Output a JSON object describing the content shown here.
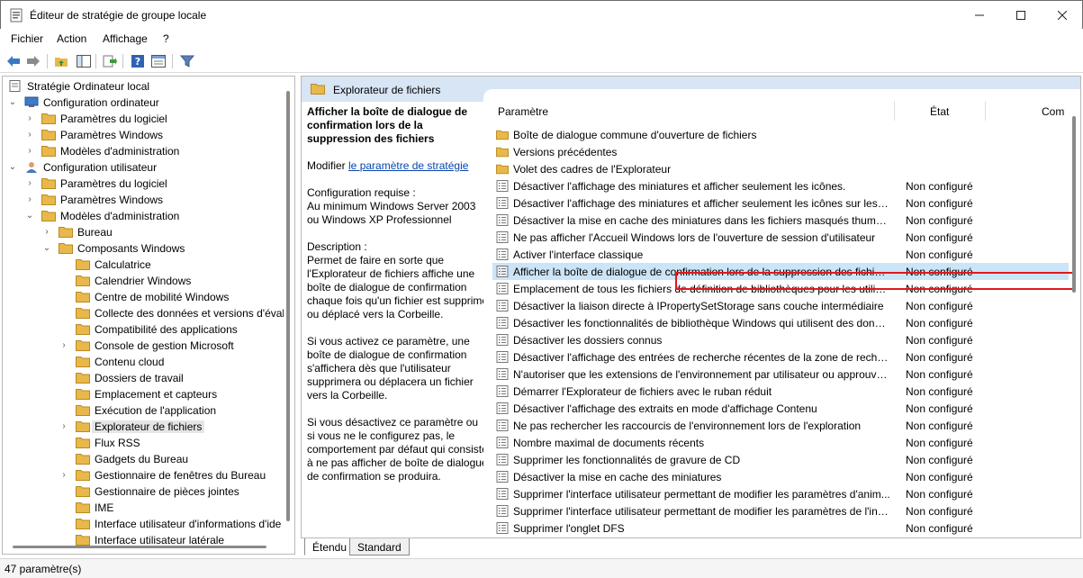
{
  "window": {
    "title": "Éditeur de stratégie de groupe locale"
  },
  "menu": [
    "Fichier",
    "Action",
    "Affichage",
    "?"
  ],
  "toolbar": {
    "icons": [
      "back-arrow-icon",
      "forward-arrow-icon",
      "up-folder-icon",
      "show-hide-tree-icon",
      "export-list-icon",
      "help-icon",
      "properties-icon",
      "filter-icon"
    ]
  },
  "tree": {
    "root": "Stratégie Ordinateur local",
    "nodes": [
      {
        "label": "Configuration ordinateur",
        "depth": 1,
        "expander": "open",
        "icon": "computer-icon"
      },
      {
        "label": "Paramètres du logiciel",
        "depth": 2,
        "expander": "closed",
        "icon": "folder-icon"
      },
      {
        "label": "Paramètres Windows",
        "depth": 2,
        "expander": "closed",
        "icon": "folder-icon"
      },
      {
        "label": "Modèles d'administration",
        "depth": 2,
        "expander": "closed",
        "icon": "folder-icon"
      },
      {
        "label": "Configuration utilisateur",
        "depth": 1,
        "expander": "open",
        "icon": "user-icon"
      },
      {
        "label": "Paramètres du logiciel",
        "depth": 2,
        "expander": "closed",
        "icon": "folder-icon"
      },
      {
        "label": "Paramètres Windows",
        "depth": 2,
        "expander": "closed",
        "icon": "folder-icon"
      },
      {
        "label": "Modèles d'administration",
        "depth": 2,
        "expander": "open",
        "icon": "folder-icon"
      },
      {
        "label": "Bureau",
        "depth": 3,
        "expander": "closed",
        "icon": "folder-icon"
      },
      {
        "label": "Composants Windows",
        "depth": 3,
        "expander": "open",
        "icon": "folder-icon"
      },
      {
        "label": "Calculatrice",
        "depth": 4,
        "expander": "none",
        "icon": "folder-icon"
      },
      {
        "label": "Calendrier Windows",
        "depth": 4,
        "expander": "none",
        "icon": "folder-icon"
      },
      {
        "label": "Centre de mobilité Windows",
        "depth": 4,
        "expander": "none",
        "icon": "folder-icon"
      },
      {
        "label": "Collecte des données et versions d'évalu",
        "depth": 4,
        "expander": "none",
        "icon": "folder-icon"
      },
      {
        "label": "Compatibilité des applications",
        "depth": 4,
        "expander": "none",
        "icon": "folder-icon"
      },
      {
        "label": "Console de gestion Microsoft",
        "depth": 4,
        "expander": "closed",
        "icon": "folder-icon"
      },
      {
        "label": "Contenu cloud",
        "depth": 4,
        "expander": "none",
        "icon": "folder-icon"
      },
      {
        "label": "Dossiers de travail",
        "depth": 4,
        "expander": "none",
        "icon": "folder-icon"
      },
      {
        "label": "Emplacement et capteurs",
        "depth": 4,
        "expander": "none",
        "icon": "folder-icon"
      },
      {
        "label": "Exécution de l'application",
        "depth": 4,
        "expander": "none",
        "icon": "folder-icon"
      },
      {
        "label": "Explorateur de fichiers",
        "depth": 4,
        "expander": "closed",
        "icon": "folder-icon",
        "selected": true
      },
      {
        "label": "Flux RSS",
        "depth": 4,
        "expander": "none",
        "icon": "folder-icon"
      },
      {
        "label": "Gadgets du Bureau",
        "depth": 4,
        "expander": "none",
        "icon": "folder-icon"
      },
      {
        "label": "Gestionnaire de fenêtres du Bureau",
        "depth": 4,
        "expander": "closed",
        "icon": "folder-icon"
      },
      {
        "label": "Gestionnaire de pièces jointes",
        "depth": 4,
        "expander": "none",
        "icon": "folder-icon"
      },
      {
        "label": "IME",
        "depth": 4,
        "expander": "none",
        "icon": "folder-icon"
      },
      {
        "label": "Interface utilisateur d'informations d'ide",
        "depth": 4,
        "expander": "none",
        "icon": "folder-icon"
      },
      {
        "label": "Interface utilisateur latérale",
        "depth": 4,
        "expander": "none",
        "icon": "folder-icon"
      }
    ]
  },
  "right": {
    "header": "Explorateur de fichiers",
    "description": {
      "title": "Afficher la boîte de dialogue de confirmation lors de la suppression des fichiers",
      "modify_prefix": "Modifier ",
      "modify_link": "le paramètre de stratégie",
      "requirements": "Configuration requise :\nAu minimum Windows Server 2003 ou Windows XP Professionnel",
      "desc_label": "Description :",
      "desc_body": "Permet de faire en sorte que l'Explorateur de fichiers affiche une boîte de dialogue de confirmation chaque fois qu'un fichier est supprimé ou déplacé vers la Corbeille.",
      "enabled": "Si vous activez ce paramètre, une boîte de dialogue de confirmation s'affichera dès que l'utilisateur supprimera ou déplacera un fichier vers la Corbeille.",
      "disabled": "Si vous désactivez ce paramètre ou si vous ne le configurez pas, le comportement par défaut qui consiste à ne pas afficher de boîte de dialogue de confirmation se produira."
    },
    "columns": [
      "Paramètre",
      "État",
      "Com"
    ],
    "rows": [
      {
        "name": "Boîte de dialogue commune d'ouverture de fichiers",
        "state": "",
        "type": "folder"
      },
      {
        "name": "Versions précédentes",
        "state": "",
        "type": "folder"
      },
      {
        "name": "Volet des cadres de l'Explorateur",
        "state": "",
        "type": "folder"
      },
      {
        "name": "Désactiver l'affichage des miniatures et afficher seulement les icônes.",
        "state": "Non configuré",
        "type": "setting"
      },
      {
        "name": "Désactiver l'affichage des miniatures et afficher seulement les icônes sur les do...",
        "state": "Non configuré",
        "type": "setting"
      },
      {
        "name": "Désactiver la mise en cache des miniatures dans les fichiers masqués thumbs.db",
        "state": "Non configuré",
        "type": "setting"
      },
      {
        "name": "Ne pas afficher l'Accueil Windows lors de l'ouverture de session d'utilisateur",
        "state": "Non configuré",
        "type": "setting"
      },
      {
        "name": "Activer l'interface classique",
        "state": "Non configuré",
        "type": "setting"
      },
      {
        "name": "Afficher la boîte de dialogue de confirmation lors de la suppression des fichiers",
        "state": "Non configuré",
        "type": "setting",
        "selected": true
      },
      {
        "name": "Emplacement de tous les fichiers de définition de bibliothèques pour les utilisa...",
        "state": "Non configuré",
        "type": "setting"
      },
      {
        "name": "Désactiver la liaison directe à IPropertySetStorage sans couche intermédiaire",
        "state": "Non configuré",
        "type": "setting"
      },
      {
        "name": "Désactiver les fonctionnalités de bibliothèque Windows qui utilisent des donné...",
        "state": "Non configuré",
        "type": "setting"
      },
      {
        "name": "Désactiver les dossiers connus",
        "state": "Non configuré",
        "type": "setting"
      },
      {
        "name": "Désactiver l'affichage des entrées de recherche récentes de la zone de recherch...",
        "state": "Non configuré",
        "type": "setting"
      },
      {
        "name": "N'autoriser que les extensions de l'environnement par utilisateur ou approuvées",
        "state": "Non configuré",
        "type": "setting"
      },
      {
        "name": "Démarrer l'Explorateur de fichiers avec le ruban réduit",
        "state": "Non configuré",
        "type": "setting"
      },
      {
        "name": "Désactiver l'affichage des extraits en mode d'affichage Contenu",
        "state": "Non configuré",
        "type": "setting"
      },
      {
        "name": "Ne pas rechercher les raccourcis de l'environnement lors de l'exploration",
        "state": "Non configuré",
        "type": "setting"
      },
      {
        "name": "Nombre maximal de documents récents",
        "state": "Non configuré",
        "type": "setting"
      },
      {
        "name": "Supprimer les fonctionnalités de gravure de CD",
        "state": "Non configuré",
        "type": "setting"
      },
      {
        "name": "Désactiver la mise en cache des miniatures",
        "state": "Non configuré",
        "type": "setting"
      },
      {
        "name": "Supprimer l'interface utilisateur permettant de modifier les paramètres d'anim...",
        "state": "Non configuré",
        "type": "setting"
      },
      {
        "name": "Supprimer l'interface utilisateur permettant de modifier les paramètres de l'ind...",
        "state": "Non configuré",
        "type": "setting"
      },
      {
        "name": "Supprimer l'onglet DFS",
        "state": "Non configuré",
        "type": "setting"
      }
    ]
  },
  "tabs": [
    "Étendu",
    "Standard"
  ],
  "status": "47 paramètre(s)",
  "colors": {
    "header_bg": "#d7e5f5",
    "selection_bg": "#cce4f7",
    "highlight_border": "#e0191c",
    "folder": "#e8b84a"
  }
}
